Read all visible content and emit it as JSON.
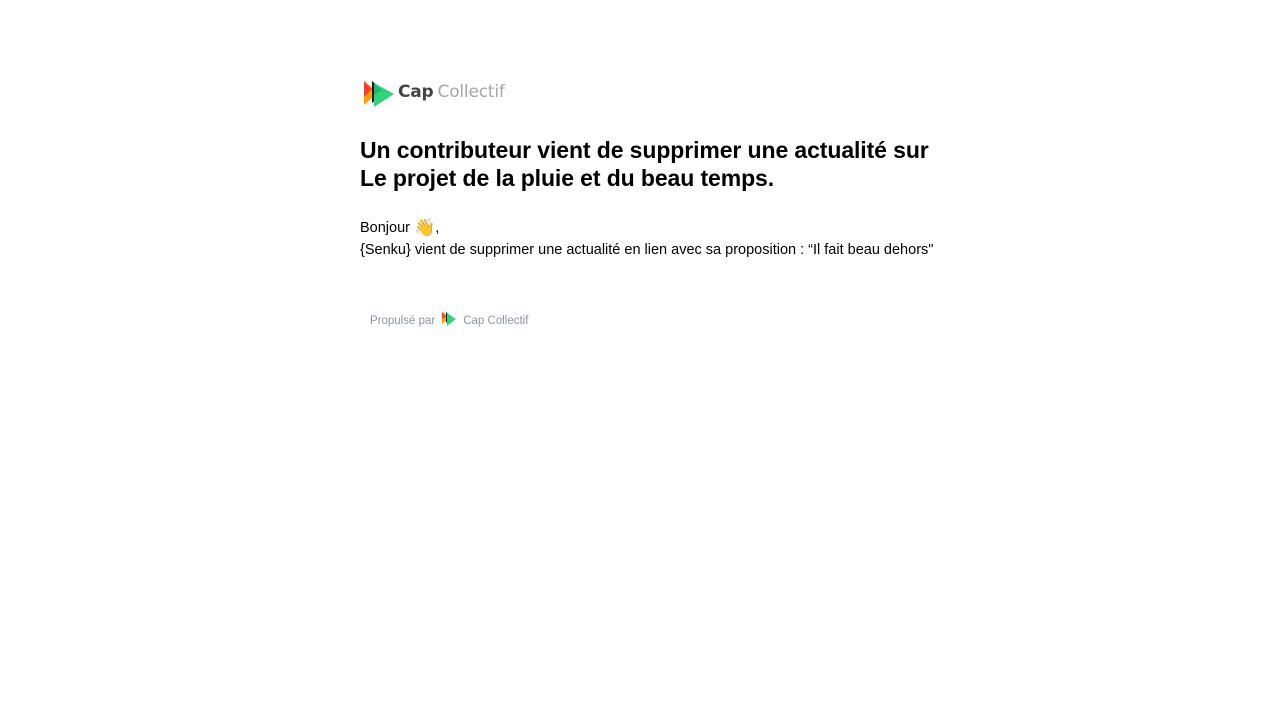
{
  "header": {
    "logo": {
      "icon": "cap-collectif-logo-icon",
      "word_cap": "Cap",
      "word_collectif": "Collectif"
    }
  },
  "notification": {
    "title": "Un contributeur vient de supprimer une actualité sur Le projet de la pluie et du beau temps.",
    "greeting": "Bonjour",
    "greeting_emoji": "👋",
    "greeting_suffix": ",",
    "message": "{Senku} vient de supprimer une actualité en lien avec sa proposition : “Il fait beau dehors\""
  },
  "footer": {
    "powered_by": "Propulsé par",
    "brand": "Cap Collectif",
    "icon": "cap-collectif-small-logo-icon"
  },
  "colors": {
    "logo_red": "#ff3b30",
    "logo_orange": "#ff9f00",
    "logo_green": "#2ed47a",
    "logo_dark": "#1a1a1a",
    "footer_text": "#8c96a0"
  }
}
